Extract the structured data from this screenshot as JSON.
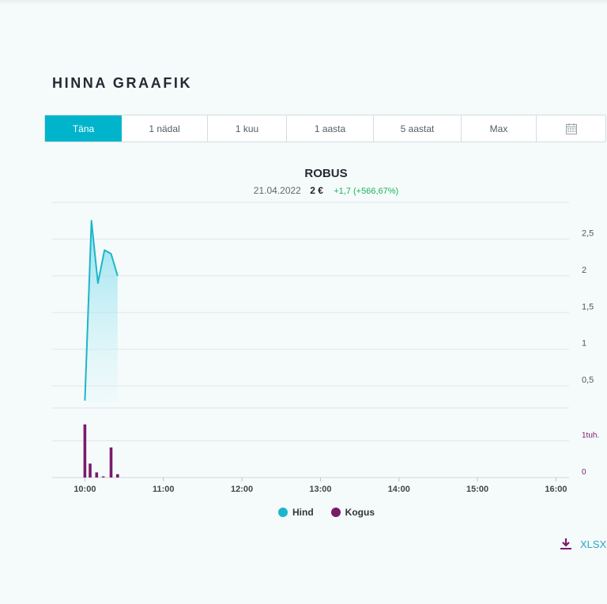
{
  "section": {
    "title": "HINNA GRAAFIK"
  },
  "range_tabs": [
    {
      "label": "Täna",
      "active": true
    },
    {
      "label": "1 nädal",
      "active": false
    },
    {
      "label": "1 kuu",
      "active": false
    },
    {
      "label": "1 aasta",
      "active": false
    },
    {
      "label": "5 aastat",
      "active": false
    },
    {
      "label": "Max",
      "active": false
    },
    {
      "label": "",
      "icon": "calendar-icon",
      "active": false
    }
  ],
  "header": {
    "title": "ROBUS",
    "date": "21.04.2022",
    "price": "2 €",
    "change": "+1,7 (+566,67%)"
  },
  "colors": {
    "accent": "#00b4cc",
    "price_line": "#1cb6ca",
    "volume": "#7a1a6a",
    "positive": "#1bb35a"
  },
  "chart_data": {
    "type": "line",
    "title": "ROBUS",
    "x_axis": {
      "ticks": [
        "10:00",
        "11:00",
        "12:00",
        "13:00",
        "14:00",
        "15:00",
        "16:00"
      ],
      "range": [
        "09:35",
        "16:10"
      ]
    },
    "price_axis": {
      "ticks": [
        "0,5",
        "1",
        "1,5",
        "2",
        "2,5"
      ],
      "range": [
        0.2,
        3.0
      ]
    },
    "volume_axis": {
      "ticks": [
        "0",
        "1tuh."
      ],
      "range": [
        0,
        1.9
      ]
    },
    "series": [
      {
        "name": "Hind",
        "type": "area",
        "x": [
          "10:00",
          "10:05",
          "10:10",
          "10:15",
          "10:20",
          "10:25"
        ],
        "values": [
          0.3,
          2.75,
          1.9,
          2.35,
          2.3,
          2.0
        ]
      },
      {
        "name": "Kogus",
        "type": "bar",
        "x": [
          "10:00",
          "10:04",
          "10:09",
          "10:14",
          "10:20",
          "10:25"
        ],
        "values": [
          1.45,
          0.38,
          0.14,
          0.03,
          0.82,
          0.09
        ]
      }
    ],
    "legend": "bottom-center",
    "grid": true
  },
  "legend": {
    "items": [
      {
        "label": "Hind"
      },
      {
        "label": "Kogus"
      }
    ]
  },
  "download": {
    "label": "XLSX",
    "icon": "download-icon"
  }
}
